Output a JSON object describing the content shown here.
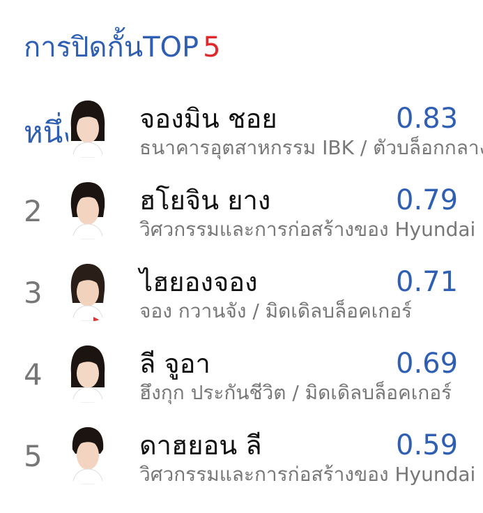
{
  "header": {
    "title": "การปิดกั้นTOP",
    "title_number": "5",
    "title_color": "#2f5fb3",
    "number_color": "#e0292c"
  },
  "players": [
    {
      "rank": "หนึ่ง",
      "name": "จองมิน ชอย",
      "score": "0.83",
      "subtitle": "ธนาคารอุตสาหกรรม IBK / ตัวบล็อกกลาง"
    },
    {
      "rank": "2",
      "name": "ฮโยจิน ยาง",
      "score": "0.79",
      "subtitle": "วิศวกรรมและการก่อสร้างของ Hyundai"
    },
    {
      "rank": "3",
      "name": "ไฮยองจอง",
      "score": "0.71",
      "subtitle": "จอง กวานจัง / มิดเดิลบล็อคเกอร์"
    },
    {
      "rank": "4",
      "name": "ลี จูอา",
      "score": "0.69",
      "subtitle": "ฮึงกุก ประกันชีวิต / มิดเดิลบล็อคเกอร์"
    },
    {
      "rank": "5",
      "name": "ดาฮยอน ลี",
      "score": "0.59",
      "subtitle": "วิศวกรรมและการก่อสร้างของ Hyundai"
    }
  ]
}
